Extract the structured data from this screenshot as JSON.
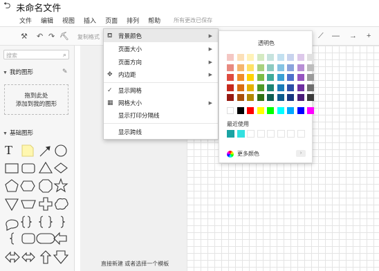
{
  "title": "未命名文件",
  "menus": [
    "文件",
    "编辑",
    "视图",
    "插入",
    "页面",
    "排列",
    "帮助"
  ],
  "save_status": "所有更改已保存",
  "toolbar": {
    "format_label": "复制格式",
    "icons": [
      "format-brush-icon",
      "undo-icon",
      "redo-icon",
      "paint-icon",
      "connector-icon",
      "line-style-icon",
      "arrow-style-icon",
      "add-icon"
    ]
  },
  "sidebar": {
    "search_placeholder": "搜索",
    "my_shapes": "我的图形",
    "drop_hint_line1": "拖到此处",
    "drop_hint_line2": "添加到我的图形",
    "basic_shapes": "基础图形"
  },
  "canvas": {
    "hint": "直接新建 或者选择一个模板"
  },
  "page_menu": {
    "items": [
      {
        "label": "背景颜色",
        "icon": "paint-bucket-icon",
        "submenu": true
      },
      {
        "label": "页面大小",
        "icon": "",
        "submenu": true
      },
      {
        "label": "页面方向",
        "icon": "",
        "submenu": true
      },
      {
        "label": "内边距",
        "icon": "padding-icon",
        "submenu": true
      },
      {
        "label": "显示网格",
        "icon": "check-icon",
        "submenu": false
      },
      {
        "label": "网格大小",
        "icon": "grid-icon",
        "submenu": true
      },
      {
        "label": "显示打印分隔线",
        "icon": "",
        "submenu": false
      },
      {
        "label": "显示跨线",
        "icon": "",
        "submenu": false
      }
    ]
  },
  "color_panel": {
    "transparent_label": "透明色",
    "recent_label": "最近使用",
    "more_label": "更多颜色",
    "grid_colors": [
      [
        "#f4c7c3",
        "#fce0b8",
        "#fff2b8",
        "#d4eac2",
        "#c6e3de",
        "#c2e0f0",
        "#c8d3ee",
        "#ddc8ea",
        "#e0e0e0"
      ],
      [
        "#e88a80",
        "#f5b66e",
        "#ffe266",
        "#a8d17f",
        "#8ccac0",
        "#85c3e3",
        "#8ba3dc",
        "#b88fd5",
        "#bdbdbd"
      ],
      [
        "#de4b3f",
        "#f08d2a",
        "#ffd300",
        "#7bbc45",
        "#3fab9a",
        "#3a9fd4",
        "#4e6fcc",
        "#9654c0",
        "#9a9a9a"
      ],
      [
        "#c62a1e",
        "#d96e12",
        "#e4b200",
        "#4f9a28",
        "#1d8474",
        "#1a7bb8",
        "#2c4ea8",
        "#6e2fa0",
        "#6e6e6e"
      ],
      [
        "#961a12",
        "#a8500a",
        "#b08800",
        "#2f7014",
        "#0e5e52",
        "#0c5a8c",
        "#173580",
        "#4a1c78",
        "#3a3a3a"
      ]
    ],
    "bright_colors": [
      "#ffffff",
      "#000000",
      "#ff0000",
      "#ffff00",
      "#00ff00",
      "#00ffff",
      "#00a8ff",
      "#0000ff",
      "#ff00ff"
    ],
    "recent_colors": [
      "#1aa3a3",
      "#33e0e0"
    ]
  }
}
